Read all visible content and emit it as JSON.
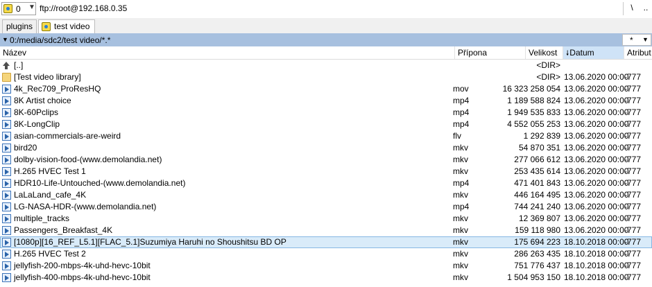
{
  "toolbar": {
    "drive_value": "0",
    "path": "ftp://root@192.168.0.35",
    "root_label": "\\",
    "up_label": ".."
  },
  "tabs": [
    {
      "label": "plugins"
    },
    {
      "label": "test video"
    }
  ],
  "pathbar": {
    "path": "0:/media/sdc2/test video/*.*",
    "filter": "*"
  },
  "columns": {
    "name": "Název",
    "ext": "Přípona",
    "size": "Velikost",
    "date": "Datum",
    "attr": "Atribut"
  },
  "files": [
    {
      "icon": "up-folder-icon",
      "name": "[..]",
      "ext": "",
      "size": "<DIR>",
      "date": "",
      "attr": ""
    },
    {
      "icon": "folder-icon",
      "name": "[Test video library]",
      "ext": "",
      "size": "<DIR>",
      "date": "13.06.2020 00:00",
      "attr": "-777"
    },
    {
      "icon": "video-file-icon",
      "name": "4k_Rec709_ProResHQ",
      "ext": "mov",
      "size": "16 323 258 054",
      "date": "13.06.2020 00:00",
      "attr": "-777"
    },
    {
      "icon": "video-file-icon",
      "name": "8K Artist choice",
      "ext": "mp4",
      "size": "1 189 588 824",
      "date": "13.06.2020 00:00",
      "attr": "-777"
    },
    {
      "icon": "video-file-icon",
      "name": "8K-60Pclips",
      "ext": "mp4",
      "size": "1 949 535 833",
      "date": "13.06.2020 00:00",
      "attr": "-777"
    },
    {
      "icon": "video-file-icon",
      "name": "8K-LongClip",
      "ext": "mp4",
      "size": "4 552 055 253",
      "date": "13.06.2020 00:00",
      "attr": "-777"
    },
    {
      "icon": "video-file-icon",
      "name": "asian-commercials-are-weird",
      "ext": "flv",
      "size": "1 292 839",
      "date": "13.06.2020 00:00",
      "attr": "-777"
    },
    {
      "icon": "video-file-icon",
      "name": "bird20",
      "ext": "mkv",
      "size": "54 870 351",
      "date": "13.06.2020 00:00",
      "attr": "-777"
    },
    {
      "icon": "video-file-icon",
      "name": "dolby-vision-food-(www.demolandia.net)",
      "ext": "mkv",
      "size": "277 066 612",
      "date": "13.06.2020 00:00",
      "attr": "-777"
    },
    {
      "icon": "video-file-icon",
      "name": "H.265 HVEC Test 1",
      "ext": "mkv",
      "size": "253 435 614",
      "date": "13.06.2020 00:00",
      "attr": "-777"
    },
    {
      "icon": "video-file-icon",
      "name": "HDR10-Life-Untouched-(www.demolandia.net)",
      "ext": "mp4",
      "size": "471 401 843",
      "date": "13.06.2020 00:00",
      "attr": "-777"
    },
    {
      "icon": "video-file-icon",
      "name": "LaLaLand_cafe_4K",
      "ext": "mkv",
      "size": "446 164 495",
      "date": "13.06.2020 00:00",
      "attr": "-777"
    },
    {
      "icon": "video-file-icon",
      "name": "LG-NASA-HDR-(www.demolandia.net)",
      "ext": "mp4",
      "size": "744 241 240",
      "date": "13.06.2020 00:00",
      "attr": "-777"
    },
    {
      "icon": "video-file-icon",
      "name": "multiple_tracks",
      "ext": "mkv",
      "size": "12 369 807",
      "date": "13.06.2020 00:00",
      "attr": "-777"
    },
    {
      "icon": "video-file-icon",
      "name": "Passengers_Breakfast_4K",
      "ext": "mkv",
      "size": "159 118 980",
      "date": "13.06.2020 00:00",
      "attr": "-777"
    },
    {
      "icon": "video-file-icon",
      "name": "[1080p][16_REF_L5.1][FLAC_5.1]Suzumiya Haruhi no Shoushitsu BD OP",
      "ext": "mkv",
      "size": "175 694 223",
      "date": "18.10.2018 00:00",
      "attr": "-777",
      "selected": true
    },
    {
      "icon": "video-file-icon",
      "name": "H.265 HVEC Test 2",
      "ext": "mkv",
      "size": "286 263 435",
      "date": "18.10.2018 00:00",
      "attr": "-777"
    },
    {
      "icon": "video-file-icon",
      "name": "jellyfish-200-mbps-4k-uhd-hevc-10bit",
      "ext": "mkv",
      "size": "751 776 437",
      "date": "18.10.2018 00:00",
      "attr": "-777"
    },
    {
      "icon": "video-file-icon",
      "name": "jellyfish-400-mbps-4k-uhd-hevc-10bit",
      "ext": "mkv",
      "size": "1 504 953 150",
      "date": "18.10.2018 00:00",
      "attr": "-777"
    }
  ]
}
